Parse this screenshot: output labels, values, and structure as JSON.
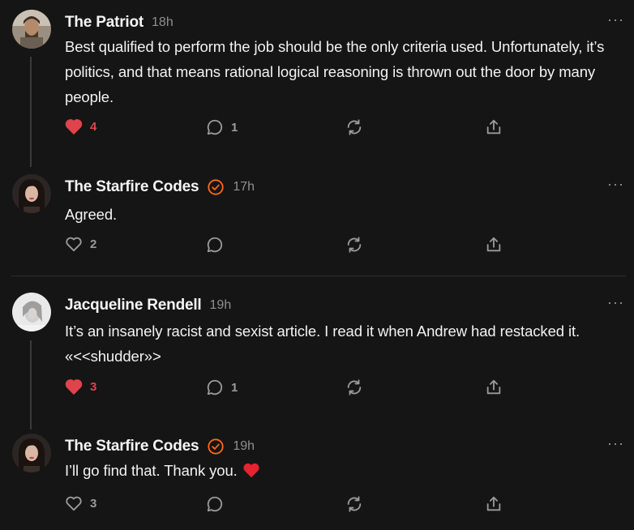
{
  "comments": [
    {
      "author": "The Patriot",
      "time": "18h",
      "verified": false,
      "text": "Best qualified to perform the job should be the only criteria used. Unfortunately, it’s politics, and that means rational logical reasoning is thrown out the door by many people.",
      "likes": "4",
      "liked": true,
      "replies": "1",
      "more_label": "···"
    },
    {
      "author": "The Starfire Codes",
      "time": "17h",
      "verified": true,
      "text": "Agreed.",
      "likes": "2",
      "liked": false,
      "replies": "",
      "more_label": "···"
    },
    {
      "author": "Jacqueline Rendell",
      "time": "19h",
      "verified": false,
      "text": "It’s an insanely racist and sexist article. I read it when Andrew had restacked it. «<<shudder»>",
      "likes": "3",
      "liked": true,
      "replies": "1",
      "more_label": "···"
    },
    {
      "author": "The Starfire Codes",
      "time": "19h",
      "verified": true,
      "text": "I’ll go find that. Thank you.",
      "likes": "3",
      "liked": false,
      "replies": "",
      "more_label": "···"
    }
  ],
  "icons": {
    "like": "heart-icon",
    "reply": "comment-bubble-icon",
    "restack": "restack-icon",
    "share": "share-icon",
    "verified": "verified-badge-icon",
    "more": "more-options-icon"
  },
  "colors": {
    "background": "#151515",
    "liked": "#e0434b",
    "verified": "#ff6719",
    "muted": "#9a9a9a"
  }
}
